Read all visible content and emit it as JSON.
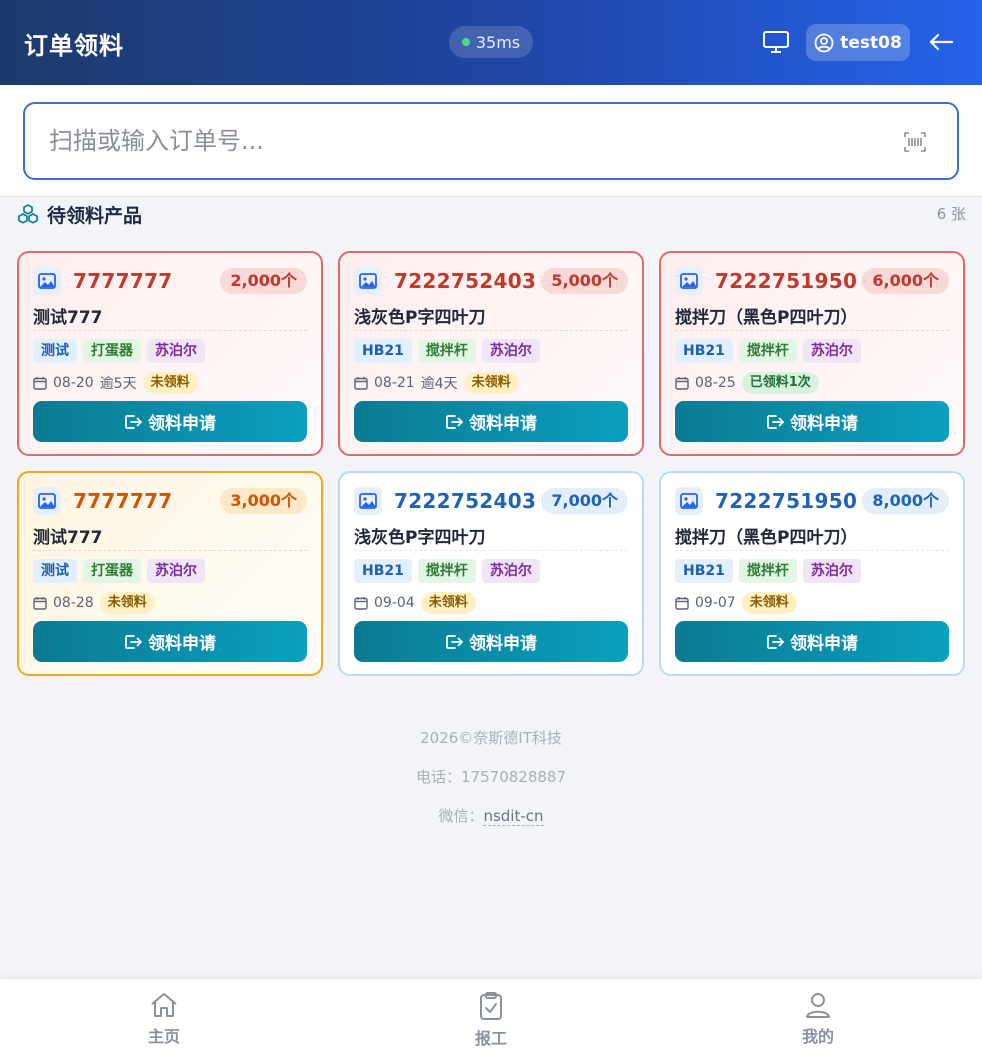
{
  "header": {
    "title": "订单领料",
    "latency": "35ms",
    "username": "test08",
    "latency_dot_color": "#4ade80"
  },
  "search": {
    "placeholder": "扫描或输入订单号...",
    "value": ""
  },
  "section": {
    "title": "待领料产品",
    "count": "6 张"
  },
  "cards": [
    {
      "theme": "red",
      "order_no": "7777777",
      "qty": "2,000个",
      "name": "测试777",
      "tags": [
        "测试",
        "打蛋器",
        "苏泊尔"
      ],
      "date": "08-20",
      "overdue": "逾5天",
      "status": "未领料",
      "status_type": "pending",
      "button": "领料申请"
    },
    {
      "theme": "red",
      "order_no": "7222752403",
      "qty": "5,000个",
      "name": "浅灰色P字四叶刀",
      "tags": [
        "HB21",
        "搅拌杆",
        "苏泊尔"
      ],
      "date": "08-21",
      "overdue": "逾4天",
      "status": "未领料",
      "status_type": "pending",
      "button": "领料申请"
    },
    {
      "theme": "red",
      "order_no": "7222751950",
      "qty": "6,000个",
      "name": "搅拌刀（黑色P四叶刀）",
      "tags": [
        "HB21",
        "搅拌杆",
        "苏泊尔"
      ],
      "date": "08-25",
      "overdue": "",
      "status": "已领料1次",
      "status_type": "done",
      "button": "领料申请"
    },
    {
      "theme": "orange",
      "order_no": "7777777",
      "qty": "3,000个",
      "name": "测试777",
      "tags": [
        "测试",
        "打蛋器",
        "苏泊尔"
      ],
      "date": "08-28",
      "overdue": "",
      "status": "未领料",
      "status_type": "pending",
      "button": "领料申请"
    },
    {
      "theme": "blue",
      "order_no": "7222752403",
      "qty": "7,000个",
      "name": "浅灰色P字四叶刀",
      "tags": [
        "HB21",
        "搅拌杆",
        "苏泊尔"
      ],
      "date": "09-04",
      "overdue": "",
      "status": "未领料",
      "status_type": "pending",
      "button": "领料申请"
    },
    {
      "theme": "blue",
      "order_no": "7222751950",
      "qty": "8,000个",
      "name": "搅拌刀（黑色P四叶刀）",
      "tags": [
        "HB21",
        "搅拌杆",
        "苏泊尔"
      ],
      "date": "09-07",
      "overdue": "",
      "status": "未领料",
      "status_type": "pending",
      "button": "领料申请"
    }
  ],
  "footer": {
    "copyright": "2026©奈斯德IT科技",
    "phone_label": "电话：",
    "phone": "17570828887",
    "wechat_label": "微信：",
    "wechat": "nsdit-cn"
  },
  "nav": {
    "home": "主页",
    "report": "报工",
    "mine": "我的"
  },
  "icons": {
    "monitor": "monitor-icon",
    "user": "user-circle-icon",
    "logout": "arrow-left-icon",
    "barcode": "barcode-scan-icon",
    "section": "boxes-icon",
    "image": "image-icon",
    "calendar": "calendar-icon",
    "apply": "export-icon",
    "home": "home-icon",
    "report": "clipboard-check-icon",
    "mine": "person-icon"
  }
}
